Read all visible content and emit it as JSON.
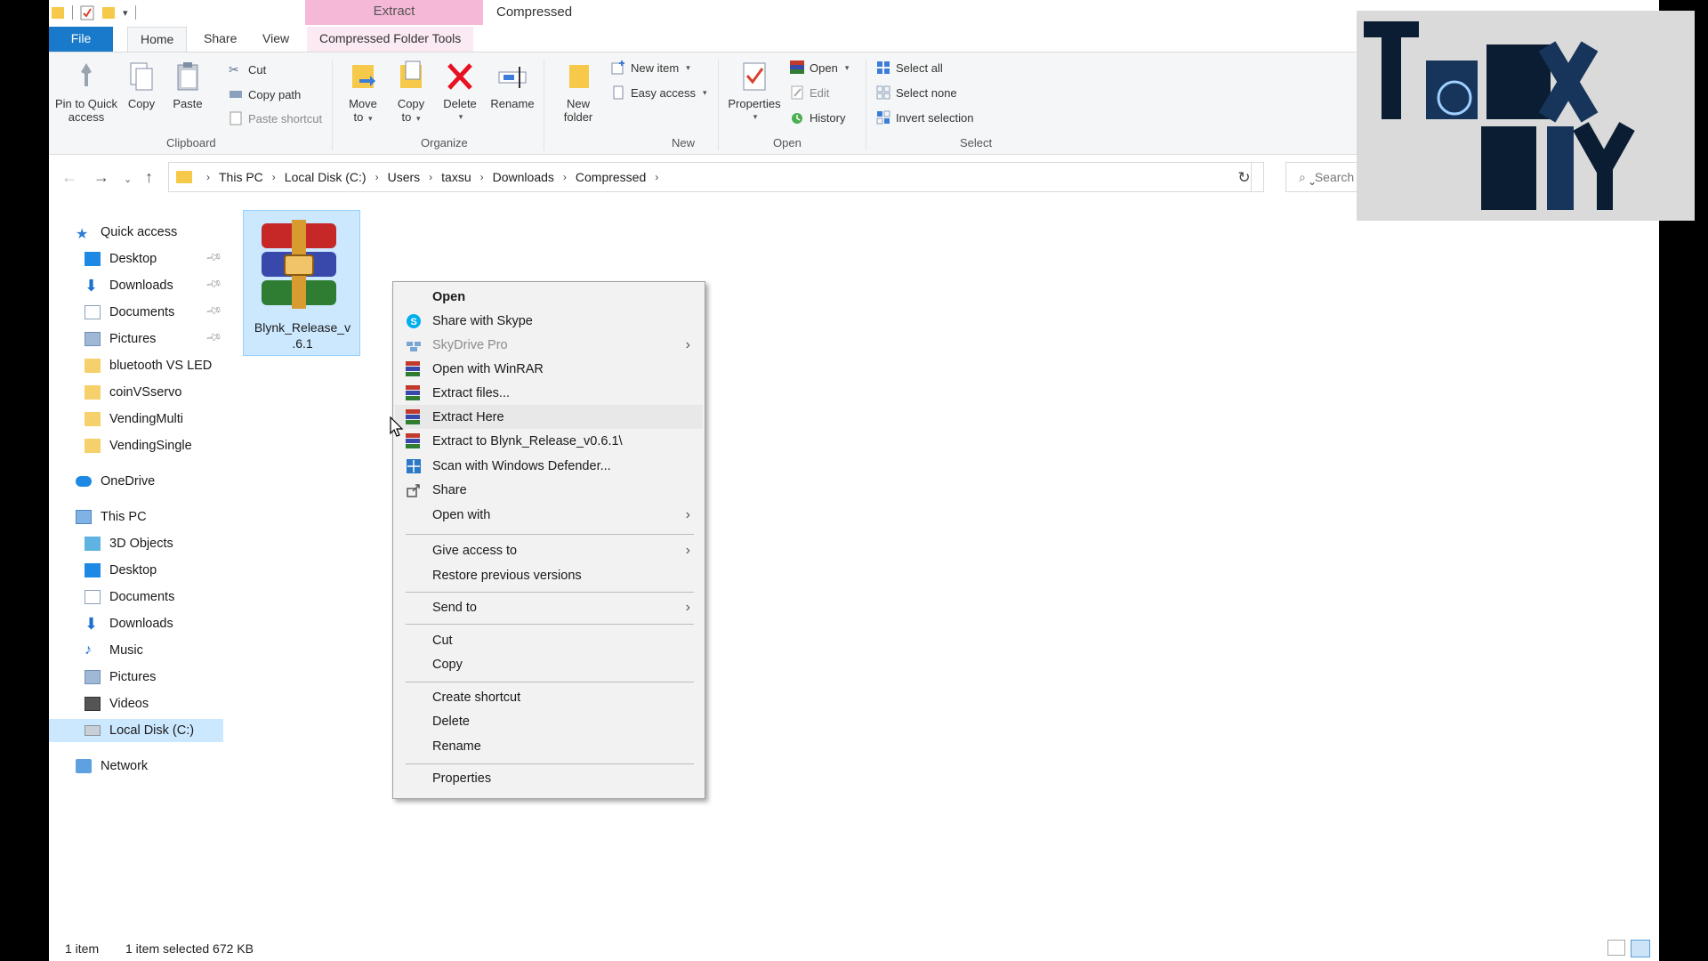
{
  "window": {
    "contextual_tab_header": "Extract",
    "title": "Compressed"
  },
  "ribbon_tabs": {
    "file": "File",
    "home": "Home",
    "share": "Share",
    "view": "View",
    "compressed_tools": "Compressed Folder Tools"
  },
  "ribbon": {
    "clipboard": {
      "label": "Clipboard",
      "pin": [
        "Pin to Quick",
        "access"
      ],
      "copy": "Copy",
      "paste": "Paste",
      "cut": "Cut",
      "copy_path": "Copy path",
      "paste_shortcut": "Paste shortcut"
    },
    "organize": {
      "label": "Organize",
      "move_to": [
        "Move",
        "to"
      ],
      "copy_to": [
        "Copy",
        "to"
      ],
      "delete": "Delete",
      "rename": "Rename"
    },
    "new": {
      "label": "New",
      "new_folder": [
        "New",
        "folder"
      ],
      "new_item": "New item",
      "easy_access": "Easy access"
    },
    "open": {
      "label": "Open",
      "properties": "Properties",
      "open": "Open",
      "edit": "Edit",
      "history": "History"
    },
    "select": {
      "label": "Select",
      "select_all": "Select all",
      "select_none": "Select none",
      "invert_selection": "Invert selection"
    }
  },
  "address_bar": {
    "crumbs": [
      "This PC",
      "Local Disk (C:)",
      "Users",
      "taxsu",
      "Downloads",
      "Compressed"
    ],
    "search_placeholder": "Search C"
  },
  "nav_pane": {
    "quick_access": "Quick access",
    "quick_items": [
      "Desktop",
      "Downloads",
      "Documents",
      "Pictures",
      "bluetooth VS LED",
      "coinVSservo",
      "VendingMulti",
      "VendingSingle"
    ],
    "onedrive": "OneDrive",
    "this_pc": "This PC",
    "pc_items": [
      "3D Objects",
      "Desktop",
      "Documents",
      "Downloads",
      "Music",
      "Pictures",
      "Videos",
      "Local Disk (C:)"
    ],
    "network": "Network"
  },
  "file": {
    "name_line1": "Blynk_Release_v",
    "name_line2": ".6.1"
  },
  "context_menu": {
    "open": "Open",
    "share_skype": "Share with Skype",
    "skydrive": "SkyDrive Pro",
    "open_winrar": "Open with WinRAR",
    "extract_files": "Extract files...",
    "extract_here": "Extract Here",
    "extract_to": "Extract to Blynk_Release_v0.6.1\\",
    "scan_defender": "Scan with Windows Defender...",
    "share": "Share",
    "open_with": "Open with",
    "give_access": "Give access to",
    "restore_versions": "Restore previous versions",
    "send_to": "Send to",
    "cut": "Cut",
    "copy": "Copy",
    "create_shortcut": "Create shortcut",
    "delete": "Delete",
    "rename": "Rename",
    "properties": "Properties"
  },
  "status_bar": {
    "item_count": "1 item",
    "selection": "1 item selected 672 KB"
  },
  "colors": {
    "file_tab": "#1979ca",
    "contextual_tab": "#f5b8d7",
    "selection": "#cce8ff",
    "delete_red": "#e81123"
  }
}
